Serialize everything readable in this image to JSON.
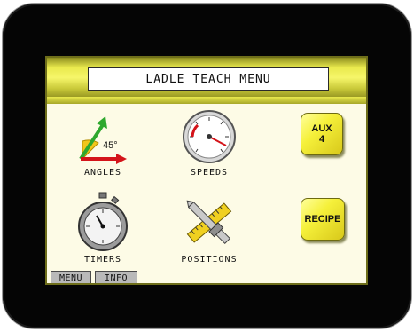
{
  "header": {
    "title": "LADLE TEACH MENU"
  },
  "tiles": [
    {
      "label": "ANGLES",
      "angle_value": "45°"
    },
    {
      "label": "SPEEDS"
    },
    {
      "label": "TIMERS"
    },
    {
      "label": "POSITIONS"
    }
  ],
  "buttons": {
    "aux_line1": "AUX",
    "aux_line2": "4",
    "recipe": "RECIPE"
  },
  "tabs": {
    "menu": "MENU",
    "info": "INFO"
  },
  "colors": {
    "panel": "#fdfbe6",
    "accent_yellow": "#f5f03a",
    "bezel": "#050505"
  }
}
